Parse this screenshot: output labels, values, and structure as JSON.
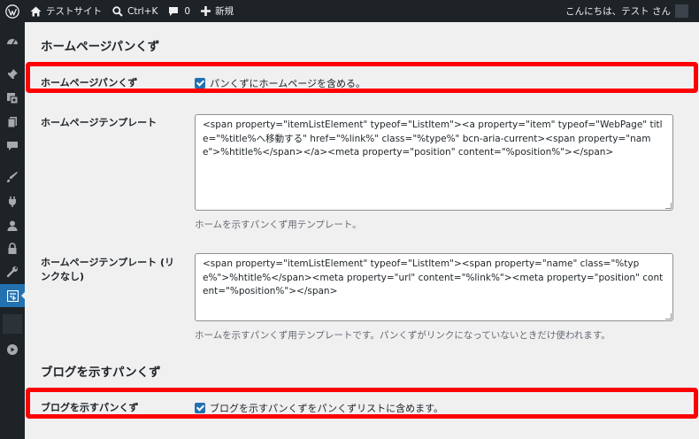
{
  "adminbar": {
    "site_name": "テストサイト",
    "search_shortcut": "Ctrl+K",
    "comments_count": "0",
    "new_label": "新規",
    "greeting": "こんにちは、テスト さん"
  },
  "sidebar": {
    "icons": [
      "dashboard-icon",
      "pin-icon",
      "media-icon",
      "pages-icon",
      "comments-icon",
      "appearance-icon",
      "plugins-icon",
      "users-icon",
      "lock-icon",
      "tools-icon",
      "breadcrumb-settings-icon",
      "play-icon"
    ]
  },
  "home_section": {
    "heading": "ホームページパンくず",
    "include_label": "ホームページパンくず",
    "include_checkbox_text": "パンくずにホームページを含める。",
    "include_checked": true,
    "template_label": "ホームページテンプレート",
    "template_value": "<span property=\"itemListElement\" typeof=\"ListItem\"><a property=\"item\" typeof=\"WebPage\" title=\"%title%へ移動する\" href=\"%link%\" class=\"%type%\" bcn-aria-current><span property=\"name\">%htitle%</span></a><meta property=\"position\" content=\"%position%\"></span>",
    "template_desc": "ホームを示すパンくず用テンプレート。",
    "template_nolink_label": "ホームページテンプレート (リンクなし)",
    "template_nolink_value": "<span property=\"itemListElement\" typeof=\"ListItem\"><span property=\"name\" class=\"%type%\">%htitle%</span><meta property=\"url\" content=\"%link%\"><meta property=\"position\" content=\"%position%\"></span>",
    "template_nolink_desc": "ホームを示すパンくず用テンプレートです。パンくずがリンクになっていないときだけ使われます。"
  },
  "blog_section": {
    "heading": "ブログを示すパンくず",
    "include_label": "ブログを示すパンくず",
    "include_checkbox_text": "ブログを示すパンくずをパンくずリストに含めます。",
    "include_checked": true
  },
  "colors": {
    "adminbar_bg": "#1d2327",
    "accent": "#2271b1",
    "highlight_border": "#ff0000",
    "content_bg": "#f0f0f1"
  }
}
